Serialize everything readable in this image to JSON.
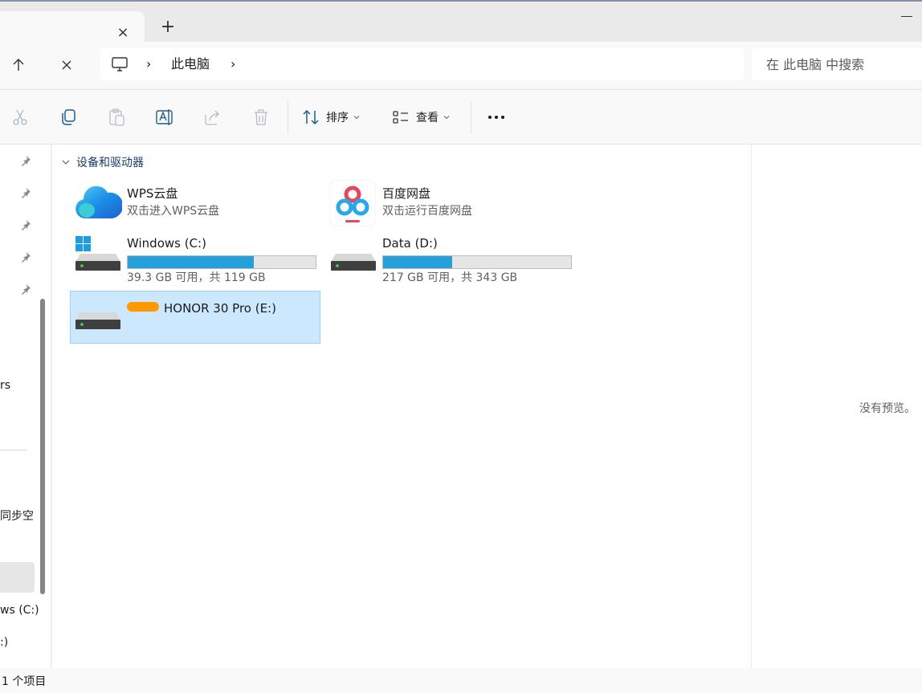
{
  "tabbar": {
    "close_glyph": "×",
    "add_glyph": "+"
  },
  "nav": {
    "up_icon": "arrow-up-icon",
    "stop_icon": "close-icon",
    "address": {
      "pc_icon": "monitor-icon",
      "sep1": "›",
      "location": "此电脑",
      "sep2": "›"
    },
    "search_placeholder": "在 此电脑 中搜索"
  },
  "toolbar": {
    "icons": [
      "cut-icon",
      "copy-icon",
      "paste-icon",
      "rename-icon",
      "share-icon",
      "delete-icon"
    ],
    "sort_label": "排序",
    "view_label": "查看",
    "more_icon": "more-icon"
  },
  "sidebar": {
    "pins": 5,
    "fragments": {
      "users": "rs",
      "sync": "同步空",
      "windows": "ws (C:)",
      "drive": ":)"
    }
  },
  "content": {
    "group_title": "设备和驱动器",
    "items": [
      {
        "name": "WPS云盘",
        "subtitle": "双击进入WPS云盘",
        "icon": "wps-cloud-icon"
      },
      {
        "name": "百度网盘",
        "subtitle": "双击运行百度网盘",
        "icon": "baidu-netdisk-icon"
      },
      {
        "name": "Windows (C:)",
        "space": "39.3 GB 可用，共 119 GB",
        "used_fraction": 0.67,
        "icon": "windows-drive-icon"
      },
      {
        "name": "Data (D:)",
        "space": "217 GB 可用，共 343 GB",
        "used_fraction": 0.367,
        "icon": "hard-drive-icon"
      },
      {
        "name": "HONOR 30 Pro (E:)",
        "icon": "hard-drive-icon",
        "selected": true
      }
    ]
  },
  "preview": {
    "text": "没有预览。"
  },
  "status": {
    "text": "1 个项目"
  },
  "colors": {
    "accent": "#26a0da",
    "selection": "#cce8ff",
    "selection_border": "#99d1ff",
    "redaction": "#ff9900"
  }
}
